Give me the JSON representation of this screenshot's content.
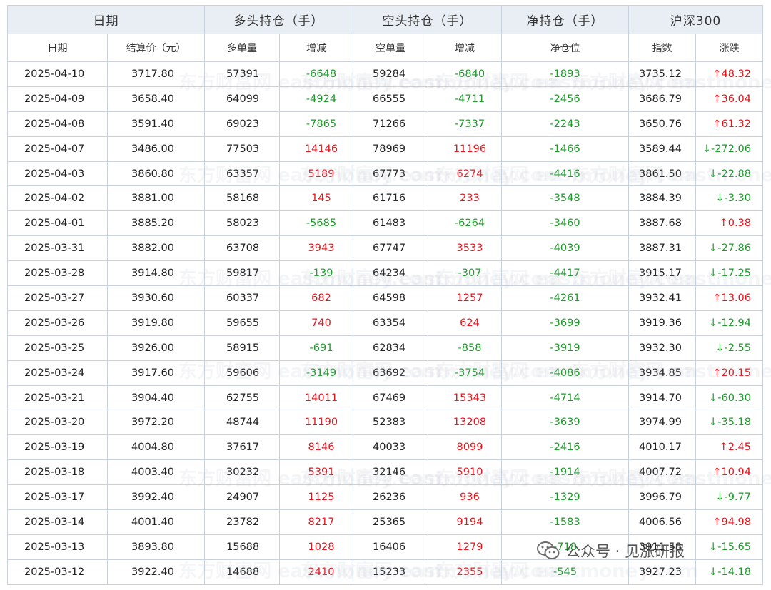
{
  "groups": {
    "date": "日期",
    "long": "多头持仓（手）",
    "short": "空头持仓（手）",
    "net": "净持仓（手）",
    "index": "沪深300"
  },
  "subheaders": {
    "date": "日期",
    "settle": "结算价（元）",
    "long_qty": "多单量",
    "long_chg": "增减",
    "short_qty": "空单量",
    "short_chg": "增减",
    "net_pos": "净仓位",
    "idx": "指数",
    "idx_chg": "涨跌"
  },
  "colors": {
    "up": "#e8141b",
    "down": "#1d9b2a",
    "header_bg": "#e9eef4",
    "border": "#c9d2dc"
  },
  "rows": [
    {
      "date": "2025-04-10",
      "settle": "3717.80",
      "long": "57391",
      "long_chg": "-6648",
      "short": "59284",
      "short_chg": "-6840",
      "net": "-1893",
      "idx": "3735.12",
      "idx_chg": "↑48.32"
    },
    {
      "date": "2025-04-09",
      "settle": "3658.40",
      "long": "64099",
      "long_chg": "-4924",
      "short": "66555",
      "short_chg": "-4711",
      "net": "-2456",
      "idx": "3686.79",
      "idx_chg": "↑36.04"
    },
    {
      "date": "2025-04-08",
      "settle": "3591.40",
      "long": "69023",
      "long_chg": "-7865",
      "short": "71266",
      "short_chg": "-7337",
      "net": "-2243",
      "idx": "3650.76",
      "idx_chg": "↑61.32"
    },
    {
      "date": "2025-04-07",
      "settle": "3486.00",
      "long": "77503",
      "long_chg": "14146",
      "short": "78969",
      "short_chg": "11196",
      "net": "-1466",
      "idx": "3589.44",
      "idx_chg": "↓-272.06"
    },
    {
      "date": "2025-04-03",
      "settle": "3860.80",
      "long": "63357",
      "long_chg": "5189",
      "short": "67773",
      "short_chg": "6274",
      "net": "-4416",
      "idx": "3861.50",
      "idx_chg": "↓-22.88"
    },
    {
      "date": "2025-04-02",
      "settle": "3881.00",
      "long": "58168",
      "long_chg": "145",
      "short": "61716",
      "short_chg": "233",
      "net": "-3548",
      "idx": "3884.39",
      "idx_chg": "↓-3.30"
    },
    {
      "date": "2025-04-01",
      "settle": "3885.20",
      "long": "58023",
      "long_chg": "-5685",
      "short": "61483",
      "short_chg": "-6264",
      "net": "-3460",
      "idx": "3887.68",
      "idx_chg": "↑0.38"
    },
    {
      "date": "2025-03-31",
      "settle": "3882.00",
      "long": "63708",
      "long_chg": "3943",
      "short": "67747",
      "short_chg": "3533",
      "net": "-4039",
      "idx": "3887.31",
      "idx_chg": "↓-27.86"
    },
    {
      "date": "2025-03-28",
      "settle": "3914.80",
      "long": "59817",
      "long_chg": "-139",
      "short": "64234",
      "short_chg": "-307",
      "net": "-4417",
      "idx": "3915.17",
      "idx_chg": "↓-17.25"
    },
    {
      "date": "2025-03-27",
      "settle": "3930.60",
      "long": "60337",
      "long_chg": "682",
      "short": "64598",
      "short_chg": "1257",
      "net": "-4261",
      "idx": "3932.41",
      "idx_chg": "↑13.06"
    },
    {
      "date": "2025-03-26",
      "settle": "3919.80",
      "long": "59655",
      "long_chg": "740",
      "short": "63354",
      "short_chg": "624",
      "net": "-3699",
      "idx": "3919.36",
      "idx_chg": "↓-12.94"
    },
    {
      "date": "2025-03-25",
      "settle": "3926.00",
      "long": "58915",
      "long_chg": "-691",
      "short": "62834",
      "short_chg": "-858",
      "net": "-3919",
      "idx": "3932.30",
      "idx_chg": "↓-2.55"
    },
    {
      "date": "2025-03-24",
      "settle": "3917.60",
      "long": "59606",
      "long_chg": "-3149",
      "short": "63692",
      "short_chg": "-3754",
      "net": "-4086",
      "idx": "3934.85",
      "idx_chg": "↑20.15"
    },
    {
      "date": "2025-03-21",
      "settle": "3904.40",
      "long": "62755",
      "long_chg": "14011",
      "short": "67469",
      "short_chg": "15343",
      "net": "-4714",
      "idx": "3914.70",
      "idx_chg": "↓-60.30"
    },
    {
      "date": "2025-03-20",
      "settle": "3972.20",
      "long": "48744",
      "long_chg": "11190",
      "short": "52383",
      "short_chg": "13208",
      "net": "-3639",
      "idx": "3974.99",
      "idx_chg": "↓-35.18"
    },
    {
      "date": "2025-03-19",
      "settle": "4004.80",
      "long": "37617",
      "long_chg": "8146",
      "short": "40033",
      "short_chg": "8099",
      "net": "-2416",
      "idx": "4010.17",
      "idx_chg": "↑2.45"
    },
    {
      "date": "2025-03-18",
      "settle": "4003.40",
      "long": "30232",
      "long_chg": "5391",
      "short": "32146",
      "short_chg": "5910",
      "net": "-1914",
      "idx": "4007.72",
      "idx_chg": "↑10.94"
    },
    {
      "date": "2025-03-17",
      "settle": "3992.40",
      "long": "24907",
      "long_chg": "1125",
      "short": "26236",
      "short_chg": "936",
      "net": "-1329",
      "idx": "3996.79",
      "idx_chg": "↓-9.77"
    },
    {
      "date": "2025-03-14",
      "settle": "4001.40",
      "long": "23782",
      "long_chg": "8217",
      "short": "25365",
      "short_chg": "9194",
      "net": "-1583",
      "idx": "4006.56",
      "idx_chg": "↑94.98"
    },
    {
      "date": "2025-03-13",
      "settle": "3893.80",
      "long": "15688",
      "long_chg": "1028",
      "short": "16406",
      "short_chg": "1279",
      "net": "-718",
      "idx": "3911.58",
      "idx_chg": "↓-15.65"
    },
    {
      "date": "2025-03-12",
      "settle": "3922.40",
      "long": "14688",
      "long_chg": "2410",
      "short": "15233",
      "short_chg": "2355",
      "net": "-545",
      "idx": "3927.23",
      "idx_chg": "↓-14.18"
    }
  ],
  "watermark_text": "东方财富网 eastmoney.com",
  "wechat": {
    "icon": "wechat-icon",
    "text": "公众号 · 见涨研报"
  }
}
